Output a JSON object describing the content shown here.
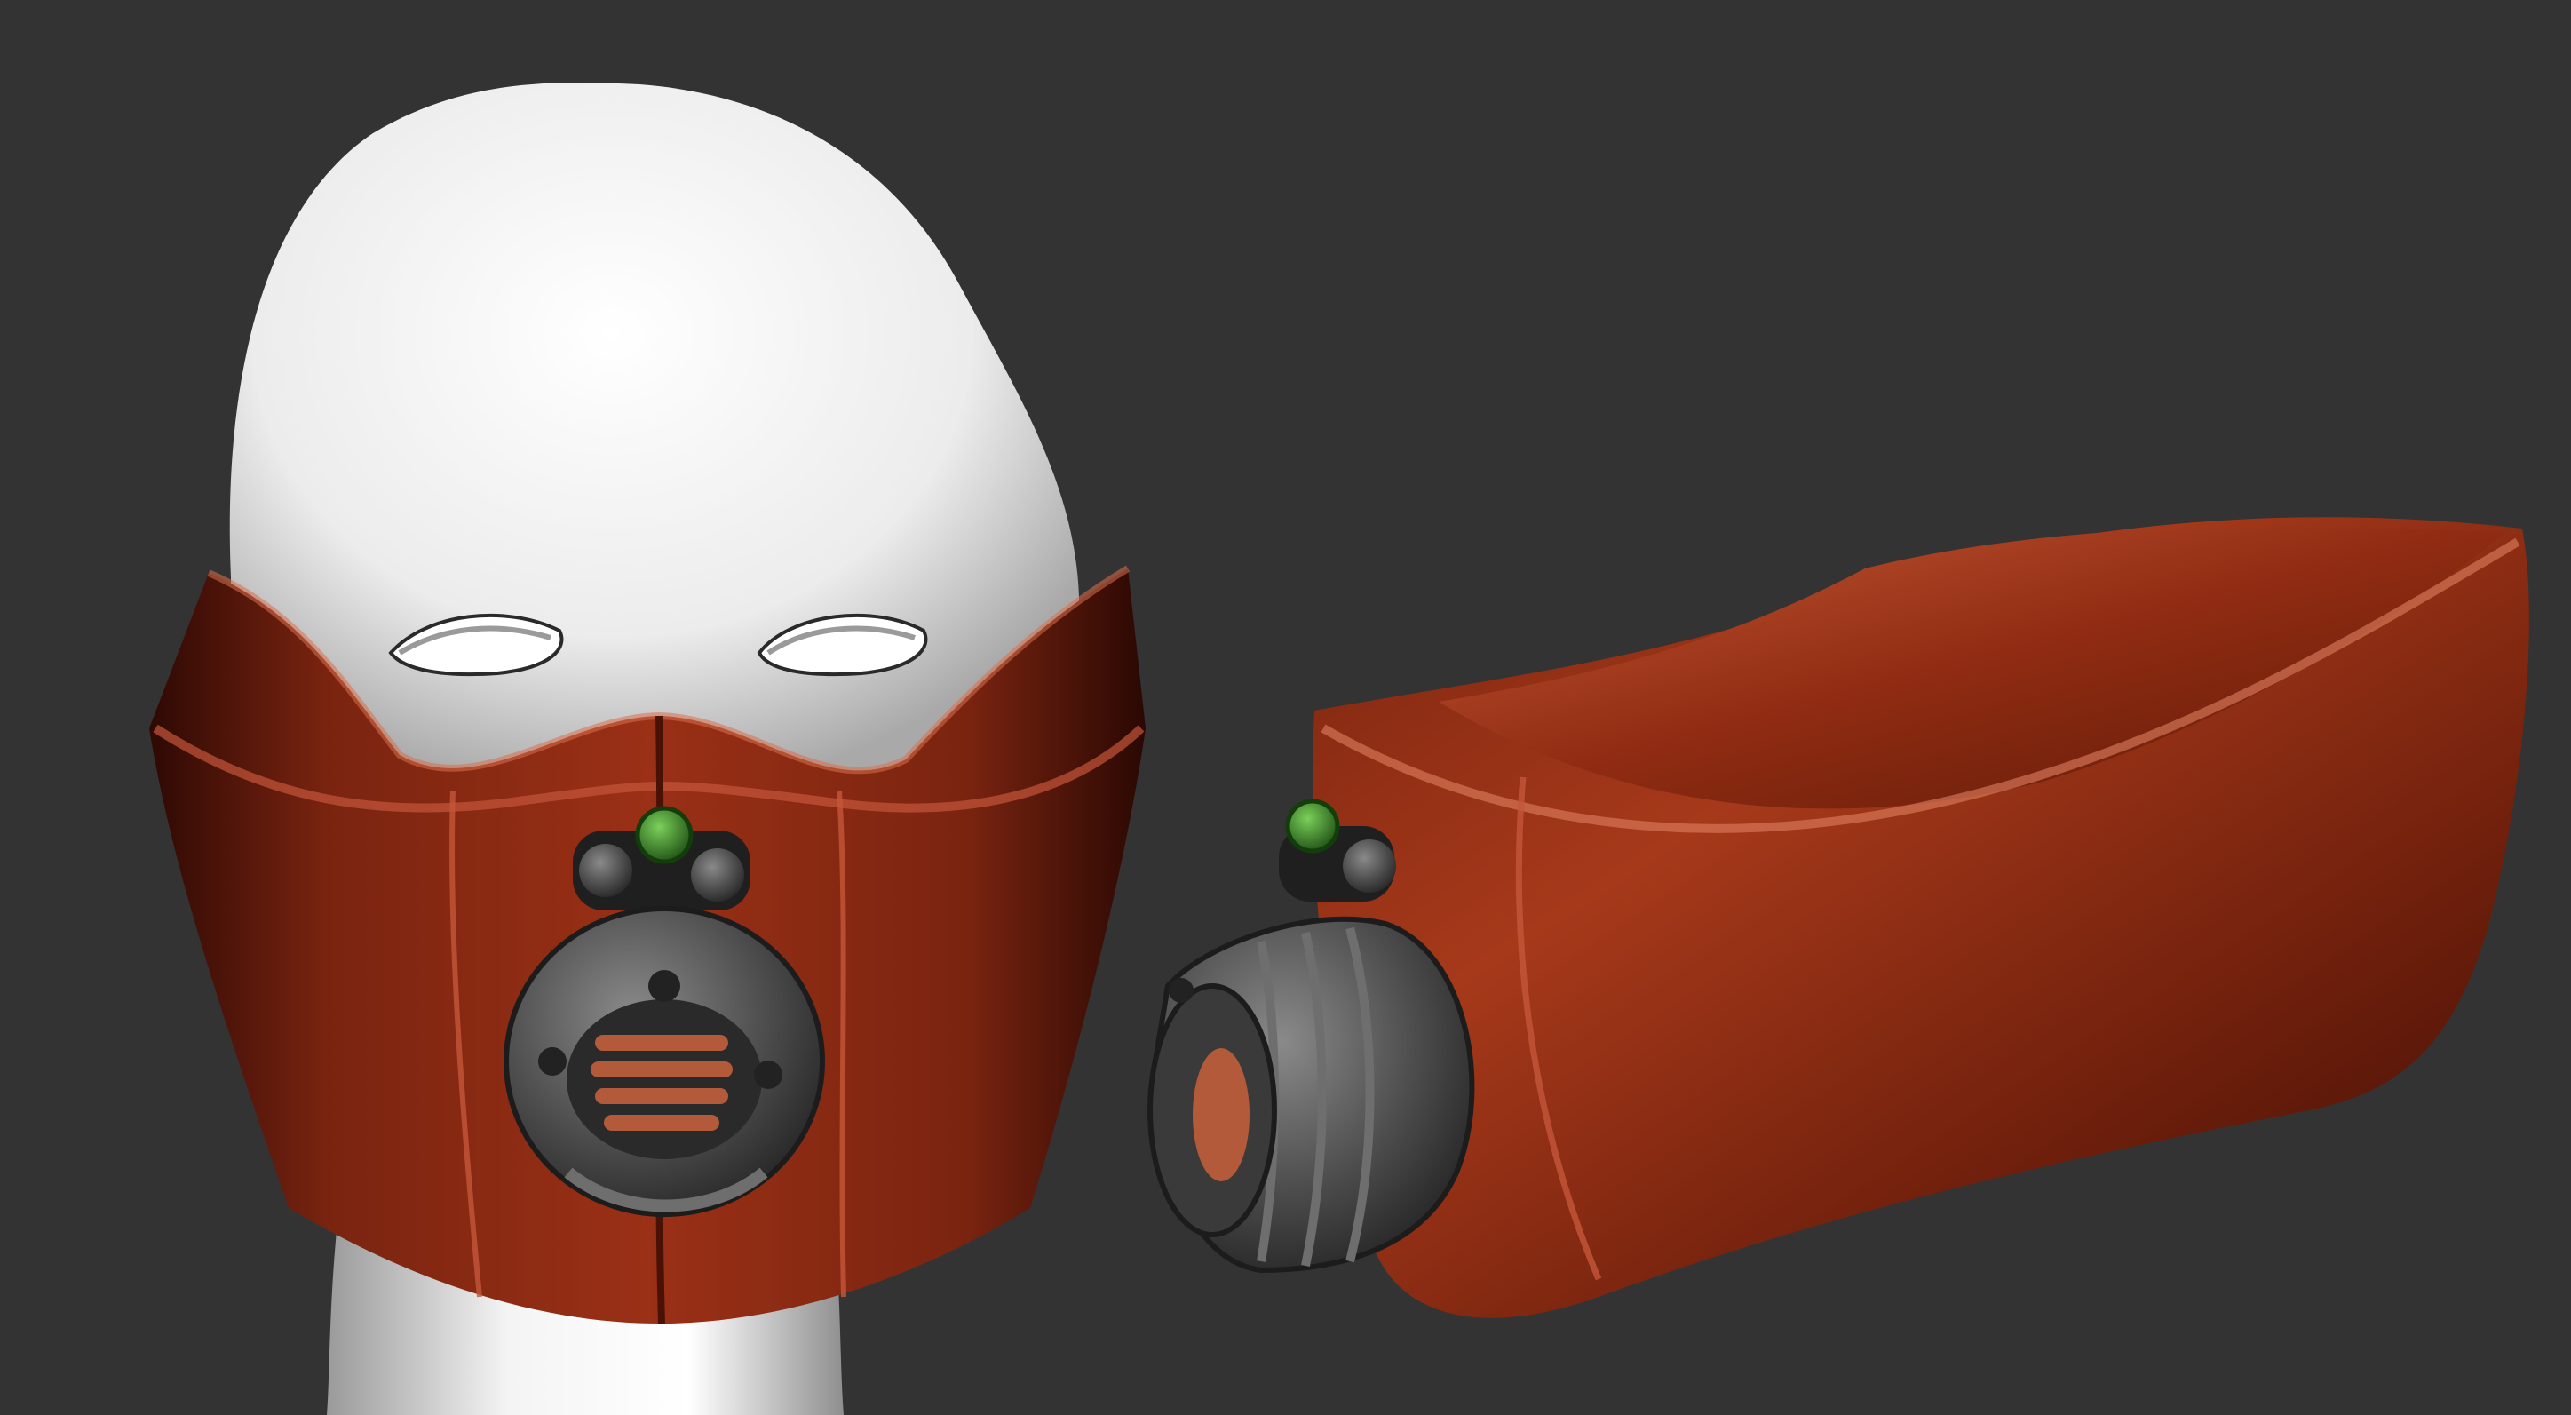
{
  "scene": {
    "background": "#333333",
    "subjects": [
      "front-view-mask-on-head",
      "side-view-mask"
    ],
    "colors": {
      "mask_leather": "#8a2a12",
      "mask_highlight": "#d46a44",
      "mask_shadow": "#3a0c04",
      "head_white": "#f2f2f2",
      "respirator_grey": "#4a4a4a",
      "valve_green": "#3c8a2a",
      "vent_copper": "#b35a3a"
    }
  }
}
